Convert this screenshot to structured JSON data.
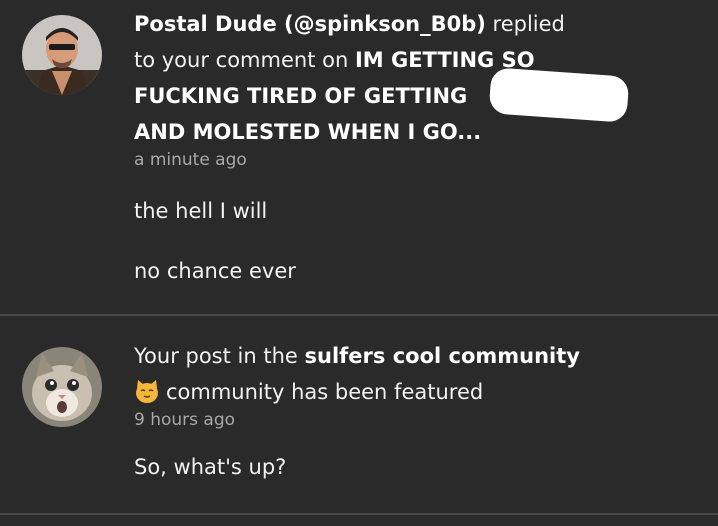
{
  "notifications": [
    {
      "user": "Postal Dude (@spinkson_B0b)",
      "action": " replied",
      "text_to": "to your comment on ",
      "post_title_part1": "IM GETTING SO",
      "post_title_part2": "FUCKING TIRED OF GETTING",
      "post_title_part3": "AND MOLESTED WHEN I GO...",
      "time": "a minute ago",
      "body_line1": "the hell I will",
      "body_line2": "no chance ever"
    },
    {
      "text_prefix": "Your post in the ",
      "community": "sulfers cool community",
      "emoji": "cat-face-icon",
      "text_suffix": "community has been featured",
      "time": "9 hours ago",
      "body": "So, what's up?"
    }
  ],
  "colors": {
    "background": "#2b2a2b",
    "divider": "#4a494a",
    "text": "#f2f2f2",
    "muted": "#a9a7a9",
    "emoji": "#f4b63b"
  }
}
